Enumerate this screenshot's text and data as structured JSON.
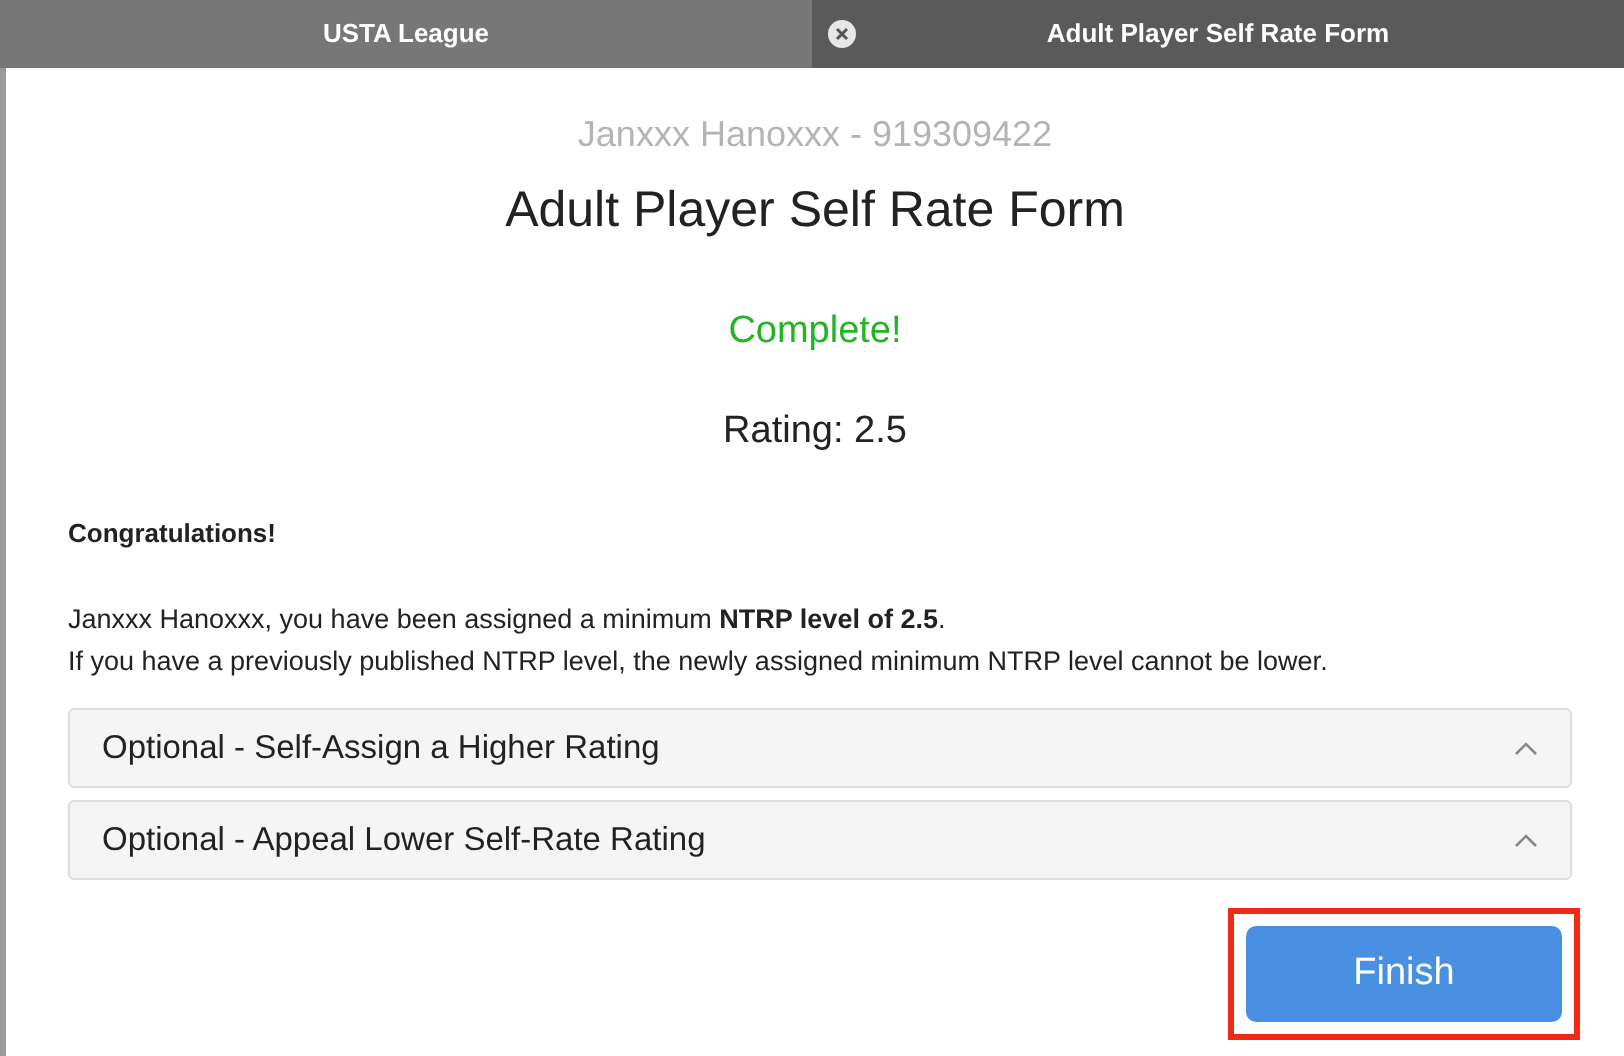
{
  "tabs": [
    {
      "label": "USTA League",
      "selected": false,
      "closable": false
    },
    {
      "label": "Adult Player Self Rate Form",
      "selected": true,
      "closable": true
    }
  ],
  "player_line": "Janxxx Hanoxxx - 919309422",
  "form_title": "Adult Player Self Rate Form",
  "status": "Complete!",
  "rating": "Rating: 2.5",
  "heading": "Congratulations!",
  "paragraphs": [
    "Janxxx Hanoxxx, you have been assigned a minimum **NTRP level of 2.5**.",
    "If you have a previously published NTRP level, the newly assigned minimum NTRP level cannot be lower."
  ],
  "sections": [
    {
      "label": "Optional - Self-Assign a Higher Rating",
      "expanded": false
    },
    {
      "label": "Optional - Appeal Lower Self-Rate Rating",
      "expanded": false
    }
  ],
  "finish_button": {
    "label": "Finish",
    "highlighted": true
  }
}
